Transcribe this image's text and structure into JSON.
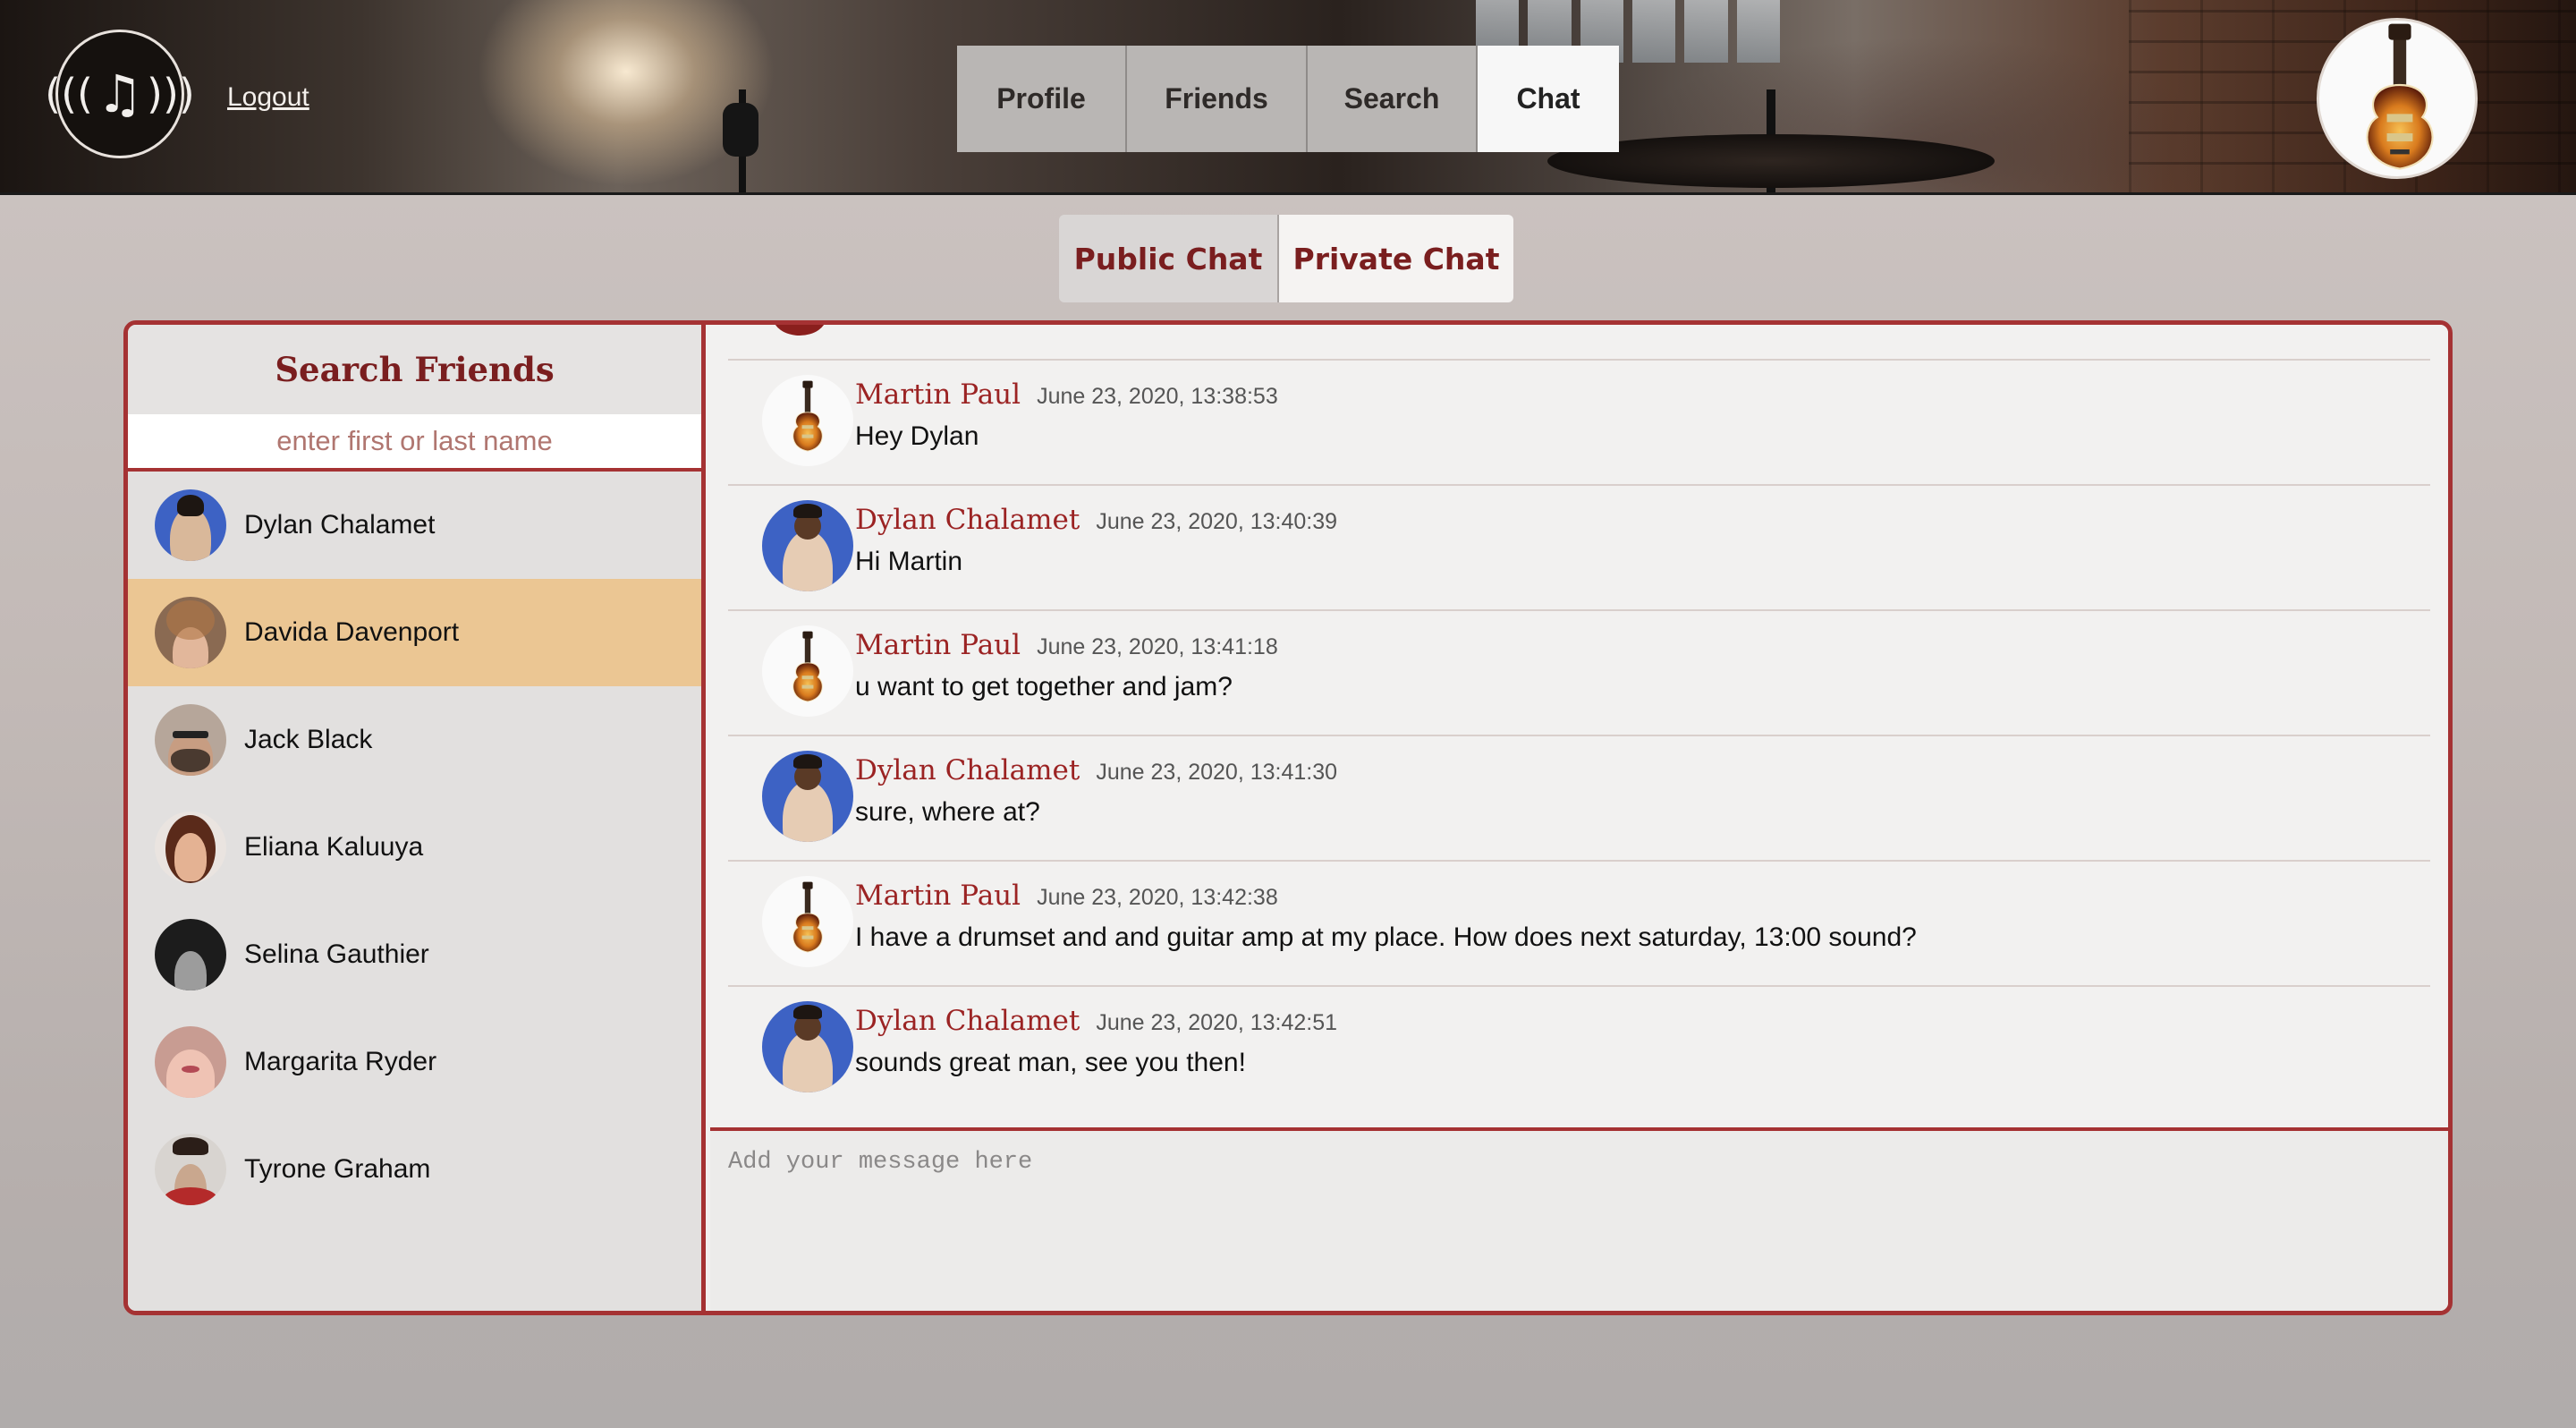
{
  "header": {
    "logo_icon": "music-note-broadcast-icon",
    "logout_label": "Logout",
    "nav": [
      {
        "label": "Profile",
        "active": false
      },
      {
        "label": "Friends",
        "active": false
      },
      {
        "label": "Search",
        "active": false
      },
      {
        "label": "Chat",
        "active": true
      }
    ],
    "profile_icon": "electric-guitar-icon"
  },
  "chat_tabs": {
    "public_label": "Public Chat",
    "private_label": "Private Chat",
    "active": "Private Chat"
  },
  "friends_panel": {
    "title": "Search Friends",
    "search_placeholder": "enter first or last name",
    "friends": [
      {
        "name": "Dylan Chalamet"
      },
      {
        "name": "Davida Davenport",
        "selected": true
      },
      {
        "name": "Jack Black"
      },
      {
        "name": "Eliana Kaluuya"
      },
      {
        "name": "Selina Gauthier"
      },
      {
        "name": "Margarita Ryder"
      },
      {
        "name": "Tyrone Graham"
      }
    ]
  },
  "messages": [
    {
      "author": "Martin Paul",
      "time": "June 23, 2020, 13:38:53",
      "text": "Hey Dylan",
      "avatar": "electric-guitar-icon"
    },
    {
      "author": "Dylan Chalamet",
      "time": "June 23, 2020, 13:40:39",
      "text": "Hi Martin",
      "avatar": "user-photo"
    },
    {
      "author": "Martin Paul",
      "time": "June 23, 2020, 13:41:18",
      "text": "u want to get together and jam?",
      "avatar": "electric-guitar-icon"
    },
    {
      "author": "Dylan Chalamet",
      "time": "June 23, 2020, 13:41:30",
      "text": "sure, where at?",
      "avatar": "user-photo"
    },
    {
      "author": "Martin Paul",
      "time": "June 23, 2020, 13:42:38",
      "text": "I have a drumset and and guitar amp at my place. How does next saturday, 13:00 sound?",
      "avatar": "electric-guitar-icon"
    },
    {
      "author": "Dylan Chalamet",
      "time": "June 23, 2020, 13:42:51",
      "text": "sounds great man, see you then!",
      "avatar": "user-photo"
    }
  ],
  "composer": {
    "placeholder": "Add your message here",
    "value": ""
  },
  "colors": {
    "accent": "#a53233",
    "author_text": "#9b2323",
    "selected_friend": "#ebc693"
  }
}
